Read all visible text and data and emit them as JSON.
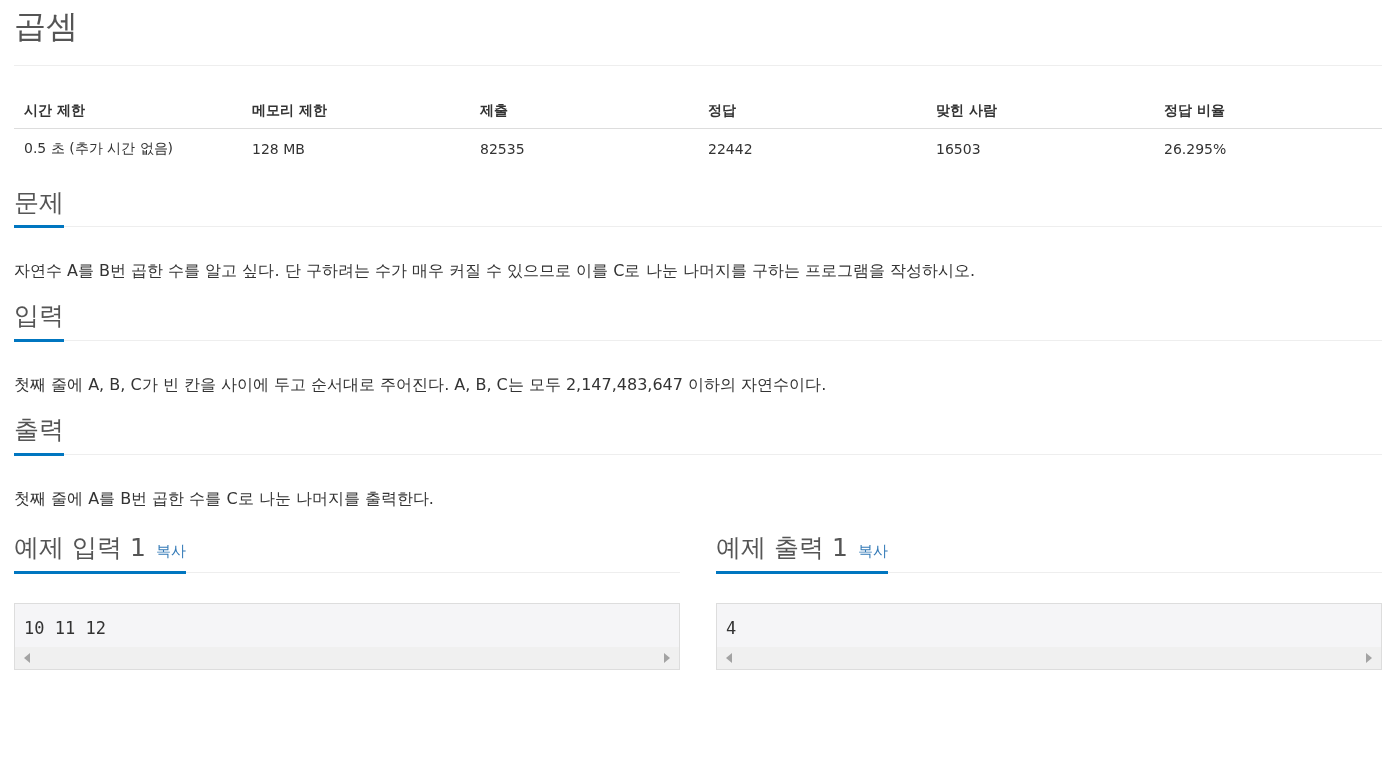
{
  "title": "곱셈",
  "info_table": {
    "columns": [
      "시간 제한",
      "메모리 제한",
      "제출",
      "정답",
      "맞힌 사람",
      "정답 비율"
    ],
    "rows": [
      [
        "0.5 초 (추가 시간 없음)",
        "128 MB",
        "82535",
        "22442",
        "16503",
        "26.295%"
      ]
    ]
  },
  "sections": [
    {
      "heading": "문제",
      "text": "자연수 A를 B번 곱한 수를 알고 싶다. 단 구하려는 수가 매우 커질 수 있으므로 이를 C로 나눈 나머지를 구하는 프로그램을 작성하시오."
    },
    {
      "heading": "입력",
      "text": "첫째 줄에 A, B, C가 빈 칸을 사이에 두고 순서대로 주어진다. A, B, C는 모두 2,147,483,647 이하의 자연수이다."
    },
    {
      "heading": "출력",
      "text": "첫째 줄에 A를 B번 곱한 수를 C로 나눈 나머지를 출력한다."
    }
  ],
  "samples": [
    {
      "heading": "예제 입력 1",
      "copy": "복사",
      "content": "10 11 12"
    },
    {
      "heading": "예제 출력 1",
      "copy": "복사",
      "content": "4"
    }
  ]
}
